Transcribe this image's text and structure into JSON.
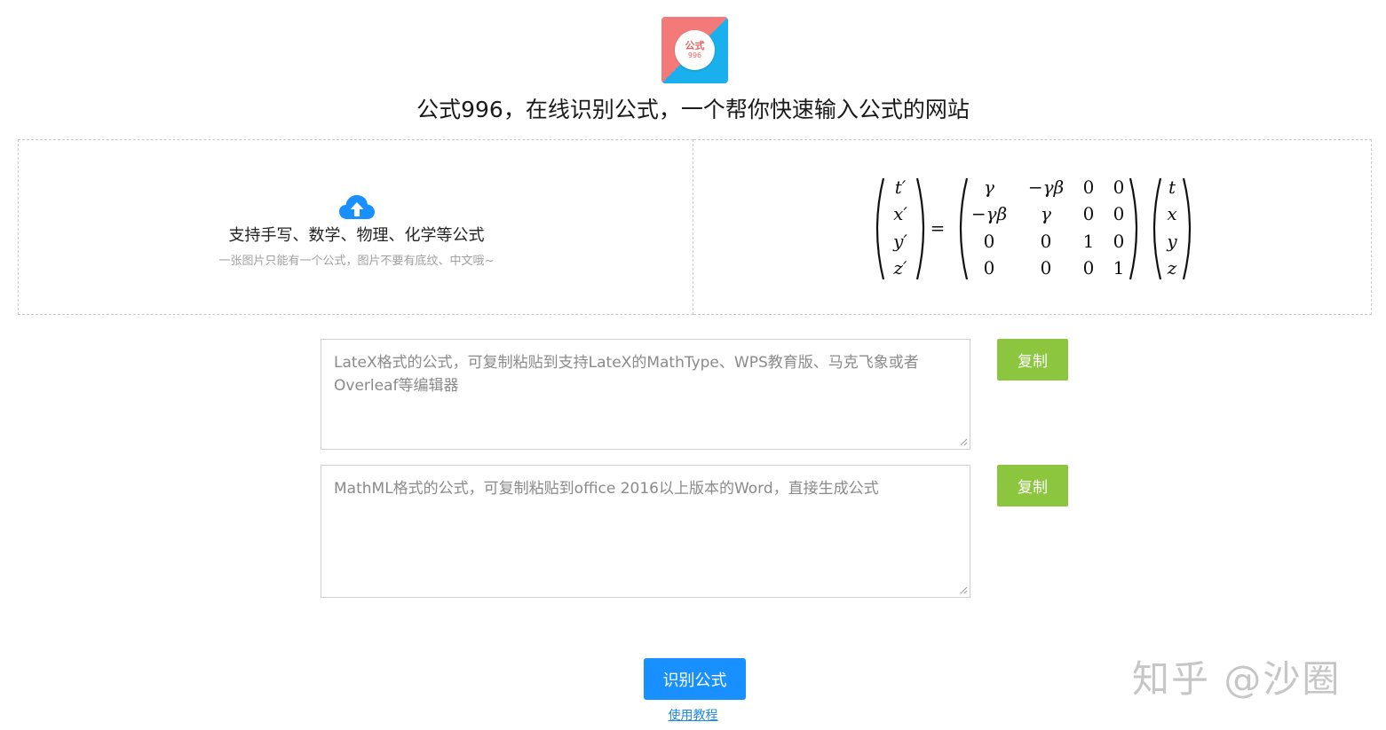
{
  "logo": {
    "line1": "公式",
    "line2": "996",
    "colors": {
      "left": "#f47a7a",
      "right": "#1ab0ee",
      "text": "#e9645f"
    }
  },
  "header": {
    "title": "公式996，在线识别公式，一个帮你快速输入公式的网站"
  },
  "upload": {
    "icon": "cloud-upload-icon",
    "title": "支持手写、数学、物理、化学等公式",
    "hint": "一张图片只能有一个公式，图片不要有底纹、中文哦~"
  },
  "preview": {
    "lhs": [
      "t′",
      "x′",
      "y′",
      "z′"
    ],
    "equals": "=",
    "matrix": [
      [
        "γ",
        "−γβ",
        "0",
        "0"
      ],
      [
        "−γβ",
        "γ",
        "0",
        "0"
      ],
      [
        "0",
        "0",
        "1",
        "0"
      ],
      [
        "0",
        "0",
        "0",
        "1"
      ]
    ],
    "rhs": [
      "t",
      "x",
      "y",
      "z"
    ]
  },
  "latex": {
    "placeholder": "LateX格式的公式，可复制粘贴到支持LateX的MathType、WPS教育版、马克飞象或者Overleaf等编辑器",
    "copy_label": "复制"
  },
  "mathml": {
    "placeholder": "MathML格式的公式，可复制粘贴到office 2016以上版本的Word，直接生成公式",
    "copy_label": "复制"
  },
  "actions": {
    "recognize_label": "识别公式",
    "tutorial_label": "使用教程"
  },
  "watermark": "知乎 @沙圈",
  "colors": {
    "accent_blue": "#1890ff",
    "copy_green": "#8cc63f",
    "link_blue": "#1e88e5"
  }
}
